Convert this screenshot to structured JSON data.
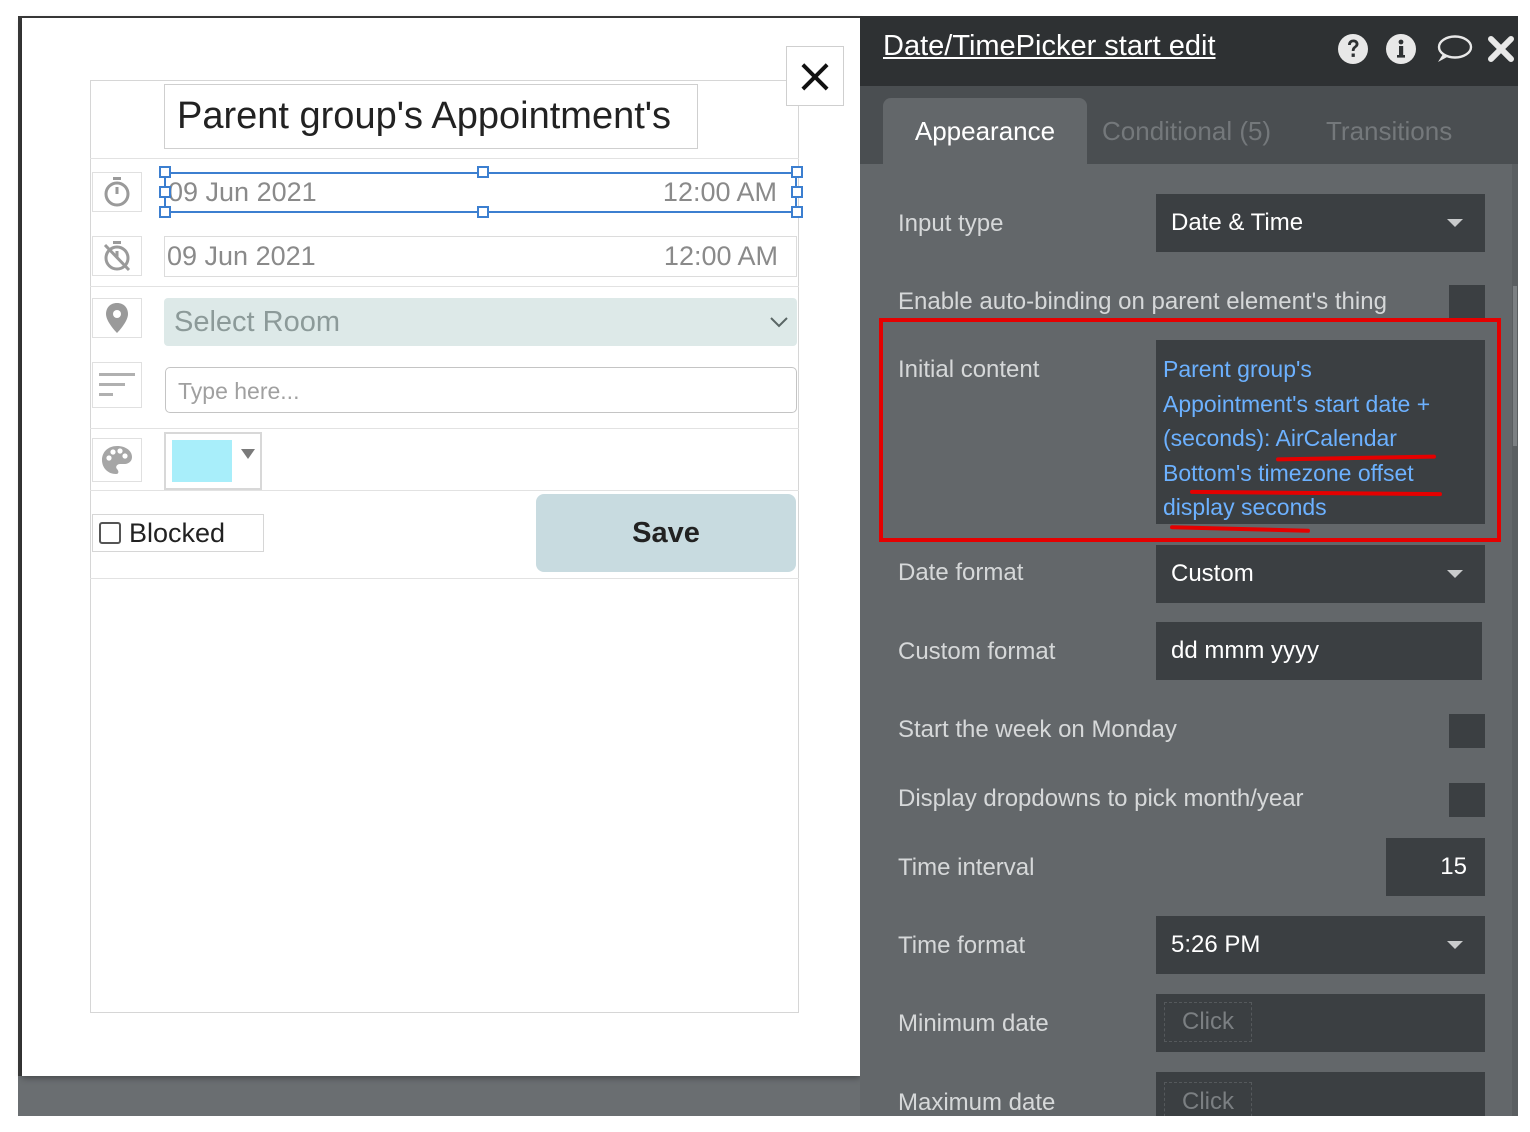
{
  "canvas": {
    "close_glyph": "×",
    "group_title": "Parent group's Appointment's",
    "start_picker": {
      "date": "09 Jun 2021",
      "time": "12:00 AM"
    },
    "end_picker": {
      "date": "09 Jun 2021",
      "time": "12:00 AM"
    },
    "room_select": {
      "placeholder": "Select Room"
    },
    "notes_input": {
      "placeholder": "Type here..."
    },
    "color_picker": {
      "swatch_color": "#a8eefa"
    },
    "blocked_checkbox": {
      "label": "Blocked"
    },
    "save_button": {
      "label": "Save"
    },
    "icons": [
      "stopwatch-icon",
      "stopwatch-off-icon",
      "map-pin-icon",
      "text-lines-icon",
      "palette-icon"
    ]
  },
  "editor": {
    "title": "Date/TimePicker start edit",
    "header_icons": [
      "help-icon",
      "info-icon",
      "comment-icon",
      "close-icon"
    ],
    "tabs": [
      {
        "label": "Appearance",
        "active": true
      },
      {
        "label": "Conditional (5)",
        "active": false
      },
      {
        "label": "Transitions",
        "active": false
      }
    ],
    "properties": {
      "input_type": {
        "label": "Input type",
        "value": "Date & Time"
      },
      "auto_binding": {
        "label": "Enable auto-binding on parent element's thing",
        "checked": false
      },
      "initial_content": {
        "label": "Initial content",
        "lines": [
          "Parent group's",
          "Appointment's start date +",
          "(seconds): AirCalendar",
          "Bottom's timezone offset",
          "display seconds"
        ]
      },
      "date_format": {
        "label": "Date format",
        "value": "Custom"
      },
      "custom_format": {
        "label": "Custom format",
        "value": "dd mmm yyyy"
      },
      "start_monday": {
        "label": "Start the week on Monday",
        "checked": false
      },
      "display_dropdowns": {
        "label": "Display dropdowns to pick month/year",
        "checked": false
      },
      "time_interval": {
        "label": "Time interval",
        "value": "15"
      },
      "time_format": {
        "label": "Time format",
        "value": "5:26 PM"
      },
      "minimum_date": {
        "label": "Minimum date",
        "value": "Click"
      },
      "maximum_date": {
        "label": "Maximum date",
        "value": "Click"
      }
    }
  },
  "colors": {
    "editor_bg": "#63676a",
    "header_bg": "#2e3133",
    "field_bg": "#3b3f42",
    "dynamic_text": "#6cb1ff",
    "highlight": "#e50000",
    "selection": "#3c7fd0",
    "save_button_bg": "#c8dbe0"
  }
}
